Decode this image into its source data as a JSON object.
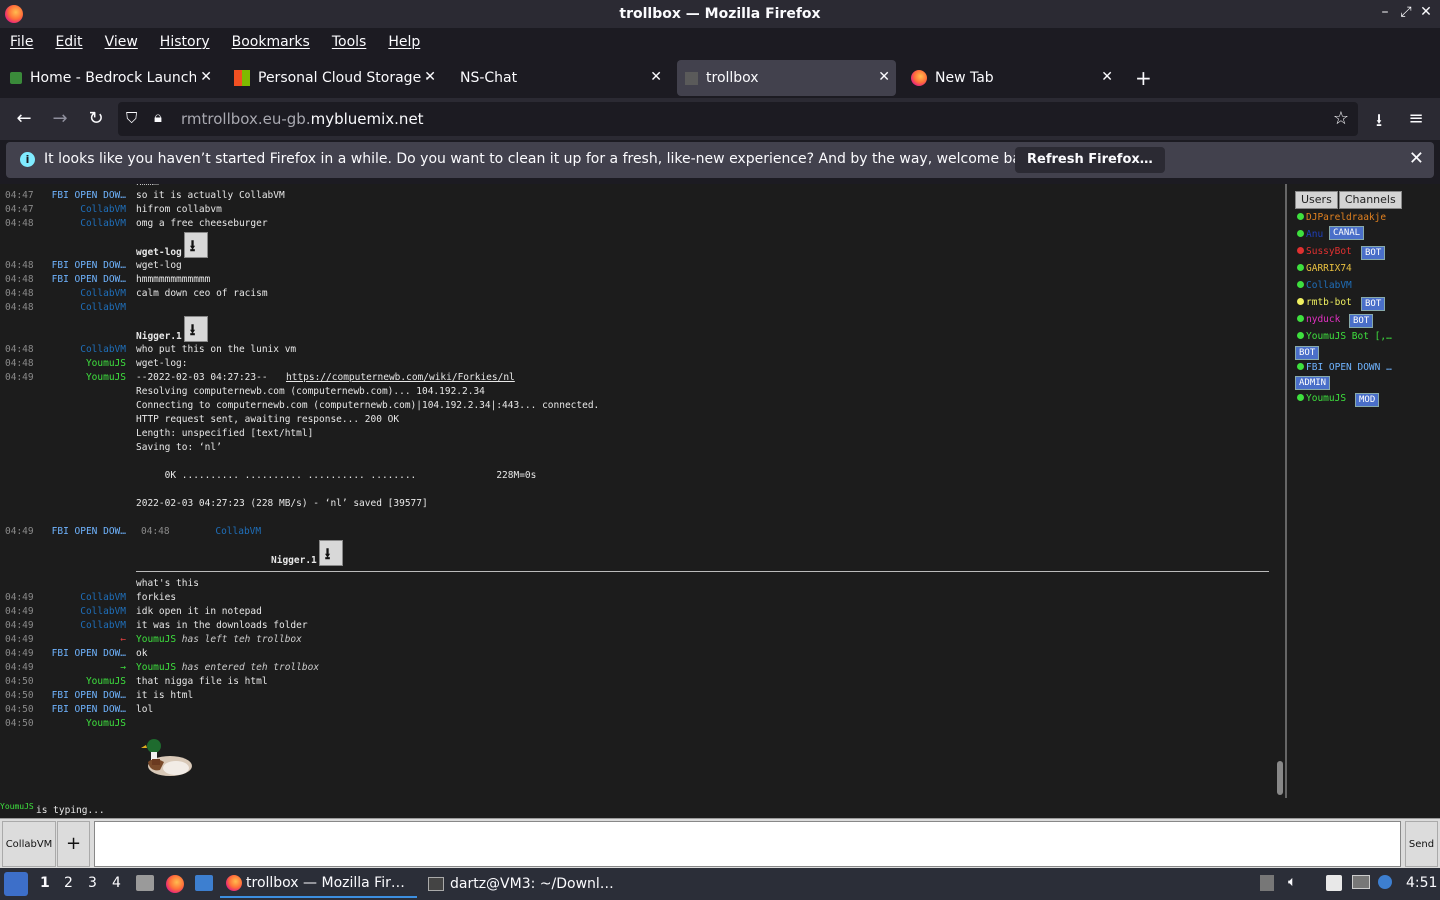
{
  "window": {
    "title": "trollbox — Mozilla Firefox"
  },
  "menu": [
    "File",
    "Edit",
    "View",
    "History",
    "Bookmarks",
    "Tools",
    "Help"
  ],
  "tabs": [
    {
      "label": "Home - Bedrock Launche"
    },
    {
      "label": "Personal Cloud Storage -"
    },
    {
      "label": "NS-Chat"
    },
    {
      "label": "trollbox"
    },
    {
      "label": "New Tab"
    }
  ],
  "url": {
    "pre": "rmtrollbox.eu-gb.",
    "domain": "mybluemix.net"
  },
  "notification": {
    "text": "It looks like you haven’t started Firefox in a while. Do you want to clean it up for a fresh, like-new experience? And by the way, welcome back!",
    "button": "Refresh Firefox…"
  },
  "chat": [
    {
      "ts": "04:47",
      "nick": "FBI OPEN DOW…",
      "cls": "c-fbi",
      "msg": "so it is actually CollabVM"
    },
    {
      "ts": "04:47",
      "nick": "CollabVM",
      "cls": "c-cvm",
      "msg": "hifrom collabvm"
    },
    {
      "ts": "04:48",
      "nick": "CollabVM",
      "cls": "c-cvm",
      "msg": "omg a free cheeseburger"
    },
    {
      "ts": "04:48",
      "nick": "FBI OPEN DOW…",
      "cls": "c-fbi",
      "msg": "wget-log"
    },
    {
      "ts": "04:48",
      "nick": "FBI OPEN DOW…",
      "cls": "c-fbi",
      "msg": "hmmmmmmmmmmmm"
    },
    {
      "ts": "04:48",
      "nick": "CollabVM",
      "cls": "c-cvm",
      "msg": "calm down ceo of racism"
    },
    {
      "ts": "04:48",
      "nick": "CollabVM",
      "cls": "c-cvm",
      "msg": ""
    },
    {
      "ts": "04:48",
      "nick": "CollabVM",
      "cls": "c-cvm",
      "msg": "who put this on the lunix vm"
    },
    {
      "ts": "04:48",
      "nick": "YoumuJS",
      "cls": "c-you",
      "msg": "wget-log:"
    },
    {
      "ts": "04:49",
      "nick": "YoumuJS",
      "cls": "c-you",
      "msg": "--2022-02-03 04:27:23--  "
    },
    {
      "ts": "04:49",
      "nick": "FBI OPEN DOW…",
      "cls": "c-fbi",
      "msg": ""
    },
    {
      "ts": "04:49",
      "nick": "CollabVM",
      "cls": "c-cvm",
      "msg": "forkies"
    },
    {
      "ts": "04:49",
      "nick": "CollabVM",
      "cls": "c-cvm",
      "msg": "idk open it in notepad"
    },
    {
      "ts": "04:49",
      "nick": "CollabVM",
      "cls": "c-cvm",
      "msg": "it was in the downloads folder"
    },
    {
      "ts": "04:49",
      "nick": "←",
      "cls": "c-red",
      "msg": ""
    },
    {
      "ts": "04:49",
      "nick": "FBI OPEN DOW…",
      "cls": "c-fbi",
      "msg": "ok"
    },
    {
      "ts": "04:49",
      "nick": "→",
      "cls": "c-you",
      "msg": ""
    },
    {
      "ts": "04:50",
      "nick": "YoumuJS",
      "cls": "c-you",
      "msg": "that nigga file is html"
    },
    {
      "ts": "04:50",
      "nick": "FBI OPEN DOW…",
      "cls": "c-fbi",
      "msg": "it is html"
    },
    {
      "ts": "04:50",
      "nick": "FBI OPEN DOW…",
      "cls": "c-fbi",
      "msg": "lol"
    },
    {
      "ts": "04:50",
      "nick": "YoumuJS",
      "cls": "c-you",
      "msg": ""
    }
  ],
  "chat_extra": {
    "top_partial": "hmmm",
    "file1": "wget-log",
    "file2": "Nigger.1",
    "file3": "Nigger.1",
    "link": "https://computernewb.com/wiki/Forkies/nl",
    "log_lines": [
      "Resolving computernewb.com (computernewb.com)... 104.192.2.34",
      "Connecting to computernewb.com (computernewb.com)|104.192.2.34|:443... connected.",
      "HTTP request sent, awaiting response... 200 OK",
      "Length: unspecified [text/html]",
      "Saving to: ‘nl’",
      "",
      "     0K .......... .......... .......... ........              228M=0s",
      "",
      "2022-02-03 04:27:23 (228 MB/s) - ‘nl’ saved [39577]"
    ],
    "quote_ts": "04:48",
    "quote_nick": "CollabVM",
    "quote_msg": "what's this",
    "left_nick": "YoumuJS",
    "left_text": " has left teh trollbox",
    "entered_nick": "YoumuJS",
    "entered_text": " has entered teh trollbox"
  },
  "sidebar": {
    "tabs": [
      "Users",
      "Channels"
    ],
    "users": [
      {
        "name": "DJPareldraakje",
        "color": "#e08020",
        "dot": "#3ee03e",
        "badge": ""
      },
      {
        "name": "Anu",
        "color": "#1f3fba",
        "dot": "#3ee03e",
        "badge": "CANAL"
      },
      {
        "name": "SussyBot",
        "color": "#e03030",
        "dot": "#e03030",
        "badge": "BOT"
      },
      {
        "name": "GARRIX74",
        "color": "#e8c040",
        "dot": "#3ee03e",
        "badge": ""
      },
      {
        "name": "CollabVM",
        "color": "#1f6fba",
        "dot": "#3ee03e",
        "badge": ""
      },
      {
        "name": "rmtb-bot",
        "color": "#f0f060",
        "dot": "#f0f060",
        "badge": "BOT"
      },
      {
        "name": "nyduck",
        "color": "#e030c0",
        "dot": "#3ee03e",
        "badge": "BOT"
      },
      {
        "name": "YoumuJS Bot [,…",
        "color": "#3ee03e",
        "dot": "#3ee03e",
        "badge": "BOT"
      },
      {
        "name": "FBI OPEN DOWN …",
        "color": "#6fb4ff",
        "dot": "#3ee03e",
        "badge": "ADMIN"
      },
      {
        "name": "YoumuJS",
        "color": "#3ee03e",
        "dot": "#3ee03e",
        "badge": "MOD"
      }
    ]
  },
  "typing": {
    "nick": "YoumuJS",
    "text": " is typing..."
  },
  "input": {
    "room": "CollabVM",
    "send": "Send"
  },
  "taskbar": {
    "workspaces": [
      "1",
      "2",
      "3",
      "4"
    ],
    "win1": "trollbox — Mozilla Fir…",
    "win2": "dartz@VM3: ~/Downl…",
    "clock": "4:51"
  }
}
